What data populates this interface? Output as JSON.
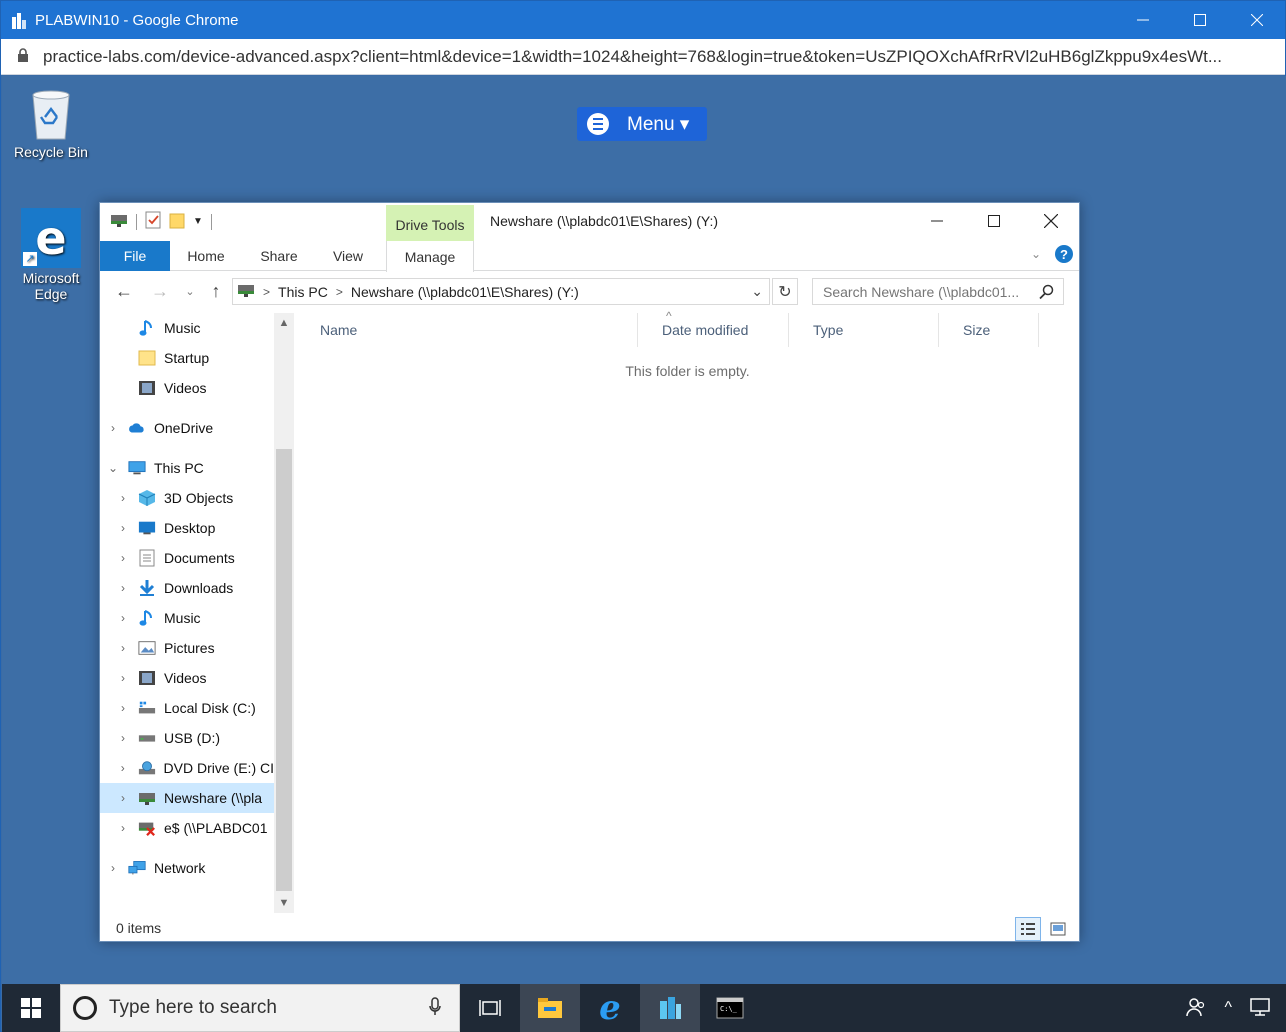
{
  "browser": {
    "title": "PLABWIN10 - Google Chrome",
    "url": "practice-labs.com/device-advanced.aspx?client=html&device=1&width=1024&height=768&login=true&token=UsZPIQOXchAfRrRVl2uHB6glZkppu9x4esWt..."
  },
  "desktop": {
    "icons": [
      {
        "label": "Recycle Bin",
        "icon": "recycle-bin-icon"
      },
      {
        "label": "Microsoft Edge",
        "icon": "edge-icon"
      }
    ],
    "menu_label": "Menu ▾"
  },
  "explorer": {
    "contextual_tab": "Drive Tools",
    "title": "Newshare (\\\\plabdc01\\E\\Shares) (Y:)",
    "ribbon_tabs": [
      "File",
      "Home",
      "Share",
      "View",
      "Manage"
    ],
    "address": {
      "crumbs": [
        "This PC",
        "Newshare (\\\\plabdc01\\E\\Shares) (Y:)"
      ]
    },
    "search_placeholder": "Search Newshare (\\\\plabdc01...",
    "nav_items": [
      {
        "label": "Music",
        "icon": "music-icon",
        "indent": 2,
        "chevron": false
      },
      {
        "label": "Startup",
        "icon": "folder-icon",
        "indent": 2,
        "chevron": false
      },
      {
        "label": "Videos",
        "icon": "videos-icon",
        "indent": 2,
        "chevron": false
      },
      {
        "label": "OneDrive",
        "icon": "onedrive-icon",
        "indent": 1,
        "chevron": "right"
      },
      {
        "label": "This PC",
        "icon": "this-pc-icon",
        "indent": 1,
        "chevron": "down"
      },
      {
        "label": "3D Objects",
        "icon": "3d-objects-icon",
        "indent": 2,
        "chevron": "right"
      },
      {
        "label": "Desktop",
        "icon": "desktop-icon",
        "indent": 2,
        "chevron": "right"
      },
      {
        "label": "Documents",
        "icon": "documents-icon",
        "indent": 2,
        "chevron": "right"
      },
      {
        "label": "Downloads",
        "icon": "downloads-icon",
        "indent": 2,
        "chevron": "right"
      },
      {
        "label": "Music",
        "icon": "music-icon",
        "indent": 2,
        "chevron": "right"
      },
      {
        "label": "Pictures",
        "icon": "pictures-icon",
        "indent": 2,
        "chevron": "right"
      },
      {
        "label": "Videos",
        "icon": "videos-icon",
        "indent": 2,
        "chevron": "right"
      },
      {
        "label": "Local Disk (C:)",
        "icon": "local-disk-icon",
        "indent": 2,
        "chevron": "right"
      },
      {
        "label": "USB (D:)",
        "icon": "usb-drive-icon",
        "indent": 2,
        "chevron": "right"
      },
      {
        "label": "DVD Drive (E:) CI",
        "icon": "dvd-drive-icon",
        "indent": 2,
        "chevron": "right"
      },
      {
        "label": "Newshare (\\\\pla",
        "icon": "network-drive-icon",
        "indent": 2,
        "chevron": "right",
        "selected": true
      },
      {
        "label": "e$ (\\\\PLABDC01",
        "icon": "disconnected-drive-icon",
        "indent": 2,
        "chevron": "right"
      },
      {
        "label": "Network",
        "icon": "network-icon",
        "indent": 1,
        "chevron": "right"
      }
    ],
    "columns": [
      "Name",
      "Date modified",
      "Type",
      "Size"
    ],
    "empty_message": "This folder is empty.",
    "status": "0 items"
  },
  "taskbar": {
    "search_placeholder": "Type here to search"
  }
}
